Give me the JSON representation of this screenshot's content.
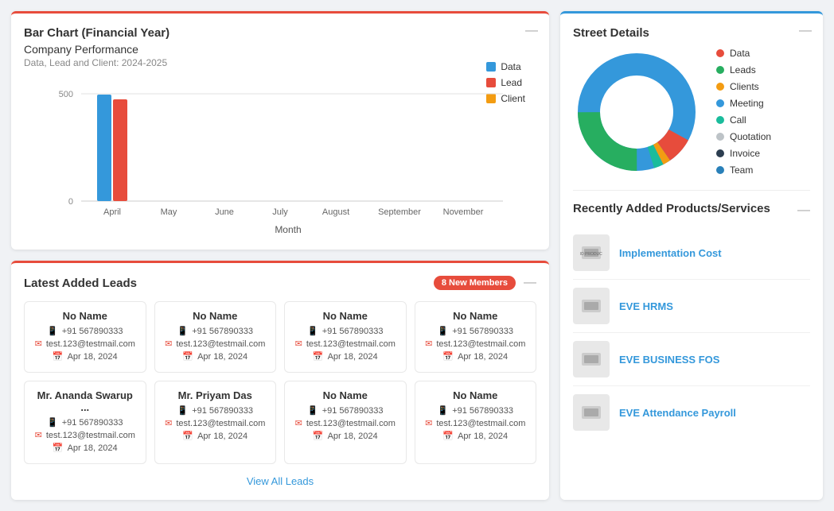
{
  "bar_chart": {
    "title": "Bar Chart (Financial Year)",
    "subtitle_line1": "Company Performance",
    "subtitle_line2": "Data, Lead and Client: 2024-2025",
    "legend": [
      {
        "label": "Data",
        "color": "#3498db"
      },
      {
        "label": "Lead",
        "color": "#e74c3c"
      },
      {
        "label": "Client",
        "color": "#f39c12"
      }
    ],
    "x_label": "Month",
    "months": [
      "April",
      "May",
      "June",
      "July",
      "August",
      "September",
      "November"
    ],
    "y_ticks": [
      "500",
      "0"
    ],
    "bars": {
      "april_data": 510,
      "april_lead": 480,
      "max": 550
    }
  },
  "street_details": {
    "title": "Street Details",
    "legend": [
      {
        "label": "Data",
        "color": "#e74c3c"
      },
      {
        "label": "Leads",
        "color": "#27ae60"
      },
      {
        "label": "Clients",
        "color": "#f39c12"
      },
      {
        "label": "Meeting",
        "color": "#3498db"
      },
      {
        "label": "Call",
        "color": "#1abc9c"
      },
      {
        "label": "Quotation",
        "color": "#bdc3c7"
      },
      {
        "label": "Invoice",
        "color": "#2c3e50"
      },
      {
        "label": "Team",
        "color": "#2980b9"
      }
    ]
  },
  "latest_leads": {
    "title": "Latest Added Leads",
    "badge": "8 New Members",
    "leads": [
      {
        "name": "No Name",
        "phone": "+91 567890333",
        "email": "test.123@testmail.com",
        "date": "Apr 18, 2024"
      },
      {
        "name": "No Name",
        "phone": "+91 567890333",
        "email": "test.123@testmail.com",
        "date": "Apr 18, 2024"
      },
      {
        "name": "No Name",
        "phone": "+91 567890333",
        "email": "test.123@testmail.com",
        "date": "Apr 18, 2024"
      },
      {
        "name": "No Name",
        "phone": "+91 567890333",
        "email": "test.123@testmail.com",
        "date": "Apr 18, 2024"
      },
      {
        "name": "Mr. Ananda Swarup ...",
        "phone": "+91 567890333",
        "email": "test.123@testmail.com",
        "date": "Apr 18, 2024"
      },
      {
        "name": "Mr. Priyam Das",
        "phone": "+91 567890333",
        "email": "test.123@testmail.com",
        "date": "Apr 18, 2024"
      },
      {
        "name": "No Name",
        "phone": "+91 567890333",
        "email": "test.123@testmail.com",
        "date": "Apr 18, 2024"
      },
      {
        "name": "No Name",
        "phone": "+91 567890333",
        "email": "test.123@testmail.com",
        "date": "Apr 18, 2024"
      }
    ],
    "view_all_label": "View All Leads"
  },
  "products": {
    "title": "Recently Added Products/Services",
    "items": [
      {
        "name": "Implementation Cost"
      },
      {
        "name": "EVE HRMS"
      },
      {
        "name": "EVE BUSINESS FOS"
      },
      {
        "name": "EVE Attendance Payroll"
      }
    ]
  },
  "minimize_symbol": "—"
}
